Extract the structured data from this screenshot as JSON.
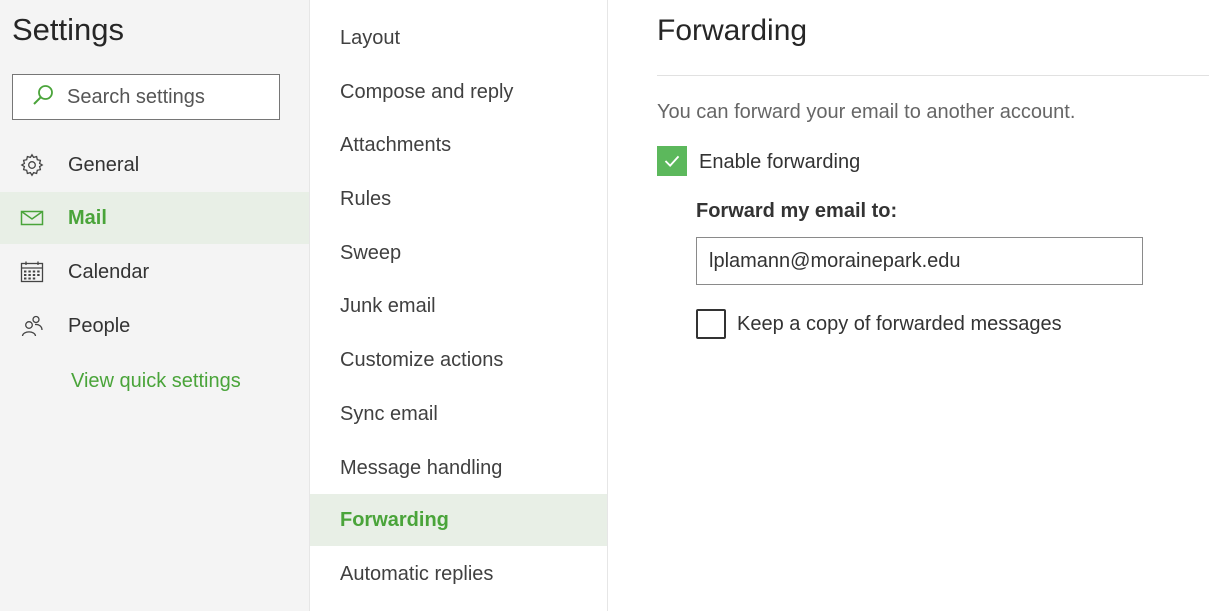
{
  "left_pane": {
    "title": "Settings",
    "search": {
      "placeholder": "Search settings",
      "value": ""
    },
    "nav": [
      {
        "label": "General",
        "icon": "gear-icon",
        "selected": false
      },
      {
        "label": "Mail",
        "icon": "mail-icon",
        "selected": true
      },
      {
        "label": "Calendar",
        "icon": "calendar-icon",
        "selected": false
      },
      {
        "label": "People",
        "icon": "people-icon",
        "selected": false
      }
    ],
    "quick_settings_link": "View quick settings"
  },
  "mail_menu": {
    "items": [
      {
        "label": "Layout",
        "selected": false
      },
      {
        "label": "Compose and reply",
        "selected": false
      },
      {
        "label": "Attachments",
        "selected": false
      },
      {
        "label": "Rules",
        "selected": false
      },
      {
        "label": "Sweep",
        "selected": false
      },
      {
        "label": "Junk email",
        "selected": false
      },
      {
        "label": "Customize actions",
        "selected": false
      },
      {
        "label": "Sync email",
        "selected": false
      },
      {
        "label": "Message handling",
        "selected": false
      },
      {
        "label": "Forwarding",
        "selected": true
      },
      {
        "label": "Automatic replies",
        "selected": false
      }
    ]
  },
  "forwarding": {
    "title": "Forwarding",
    "description": "You can forward your email to another account.",
    "enable_forwarding": {
      "label": "Enable forwarding",
      "checked": true
    },
    "forward_to_label": "Forward my email to:",
    "forward_to_value": "lplamann@morainepark.edu",
    "keep_copy": {
      "label": "Keep a copy of forwarded messages",
      "checked": false
    }
  },
  "colors": {
    "accent": "#4aa43a",
    "checkbox_fill": "#5cb85c",
    "selected_bg": "#e8efe6",
    "pane_bg": "#f4f4f4"
  }
}
